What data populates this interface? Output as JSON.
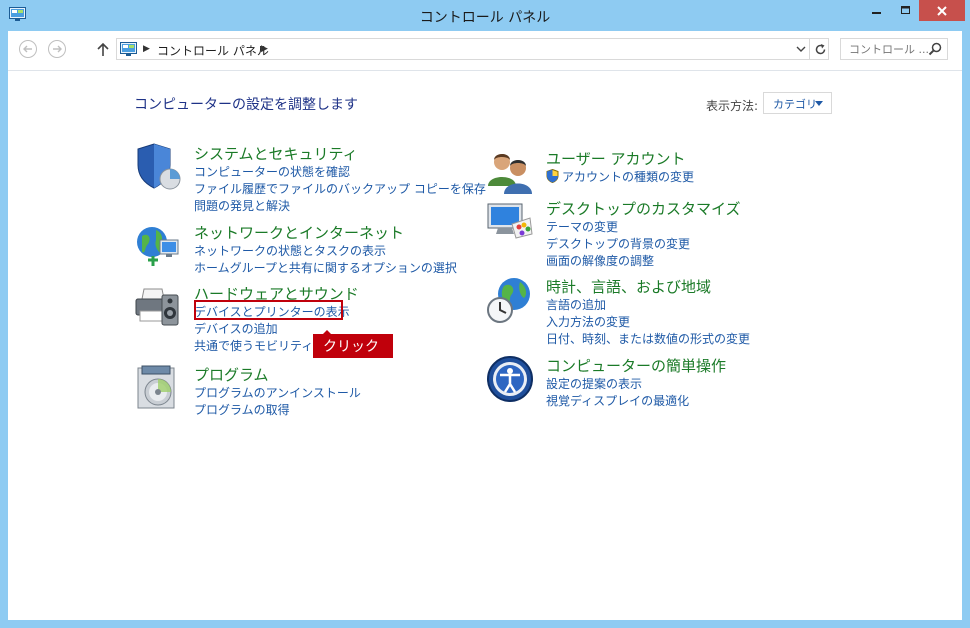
{
  "window": {
    "title": "コントロール パネル",
    "accent": "#8ecbf2",
    "close_color": "#c7504c"
  },
  "address_bar": {
    "path": "コントロール パネル"
  },
  "search": {
    "placeholder": "コントロール ..."
  },
  "main": {
    "heading": "コンピューターの設定を調整します",
    "view_label": "表示方法:",
    "view_value": "カテゴリ"
  },
  "categories_left": [
    {
      "title": "システムとセキュリティ",
      "icon": "shield-icon",
      "links": [
        "コンピューターの状態を確認",
        "ファイル履歴でファイルのバックアップ コピーを保存",
        "問題の発見と解決"
      ]
    },
    {
      "title": "ネットワークとインターネット",
      "icon": "network-globe-icon",
      "links": [
        "ネットワークの状態とタスクの表示",
        "ホームグループと共有に関するオプションの選択"
      ]
    },
    {
      "title": "ハードウェアとサウンド",
      "icon": "printer-speaker-icon",
      "links": [
        "デバイスとプリンターの表示",
        "デバイスの追加",
        "共通で使うモビリティ設定"
      ]
    },
    {
      "title": "プログラム",
      "icon": "program-disc-icon",
      "links": [
        "プログラムのアンインストール",
        "プログラムの取得"
      ]
    }
  ],
  "categories_right": [
    {
      "title": "ユーザー アカウント",
      "icon": "users-icon",
      "links": [
        "アカウントの種類の変更"
      ]
    },
    {
      "title": "デスクトップのカスタマイズ",
      "icon": "monitor-palette-icon",
      "links": [
        "テーマの変更",
        "デスクトップの背景の変更",
        "画面の解像度の調整"
      ]
    },
    {
      "title": "時計、言語、および地域",
      "icon": "clock-globe-icon",
      "links": [
        "言語の追加",
        "入力方法の変更",
        "日付、時刻、または数値の形式の変更"
      ]
    },
    {
      "title": "コンピューターの簡単操作",
      "icon": "ease-of-access-icon",
      "links": [
        "設定の提案の表示",
        "視覚ディスプレイの最適化"
      ]
    }
  ],
  "annotation": {
    "label": "クリック",
    "color": "#c0000b"
  }
}
